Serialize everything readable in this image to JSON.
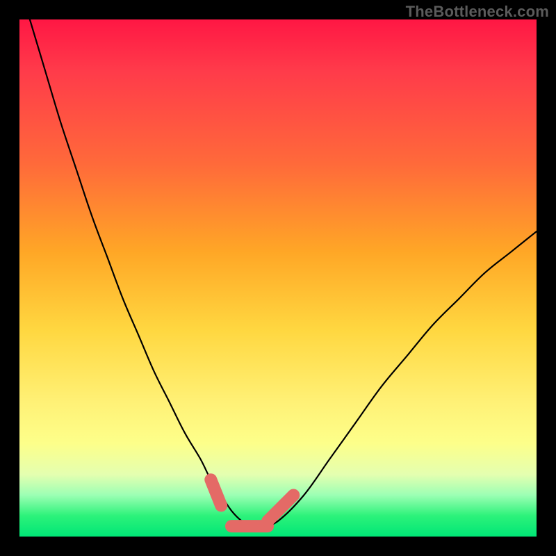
{
  "watermark": "TheBottleneck.com",
  "chart_data": {
    "type": "line",
    "title": "",
    "xlabel": "",
    "ylabel": "",
    "xlim": [
      0,
      100
    ],
    "ylim": [
      0,
      100
    ],
    "series": [
      {
        "name": "bottleneck-curve",
        "x": [
          2,
          5,
          8,
          11,
          14,
          17,
          20,
          23,
          26,
          29,
          32,
          35,
          37,
          39,
          41,
          43,
          45,
          47,
          50,
          55,
          60,
          65,
          70,
          75,
          80,
          85,
          90,
          95,
          100
        ],
        "y": [
          100,
          90,
          80,
          71,
          62,
          54,
          46,
          39,
          32,
          26,
          20,
          15,
          11,
          8,
          5,
          3,
          2,
          2,
          3,
          8,
          15,
          22,
          29,
          35,
          41,
          46,
          51,
          55,
          59
        ]
      }
    ],
    "markers": [
      {
        "name": "left-dash",
        "x": [
          37,
          39
        ],
        "y": [
          11,
          6
        ]
      },
      {
        "name": "flat-dash",
        "x": [
          41,
          48
        ],
        "y": [
          2,
          2
        ]
      },
      {
        "name": "right-dash",
        "x": [
          48,
          53
        ],
        "y": [
          3,
          8
        ]
      }
    ],
    "gradient_stops": [
      {
        "pos": 0,
        "color": "#ff1744"
      },
      {
        "pos": 45,
        "color": "#ffa726"
      },
      {
        "pos": 74,
        "color": "#fff176"
      },
      {
        "pos": 100,
        "color": "#00e676"
      }
    ]
  }
}
